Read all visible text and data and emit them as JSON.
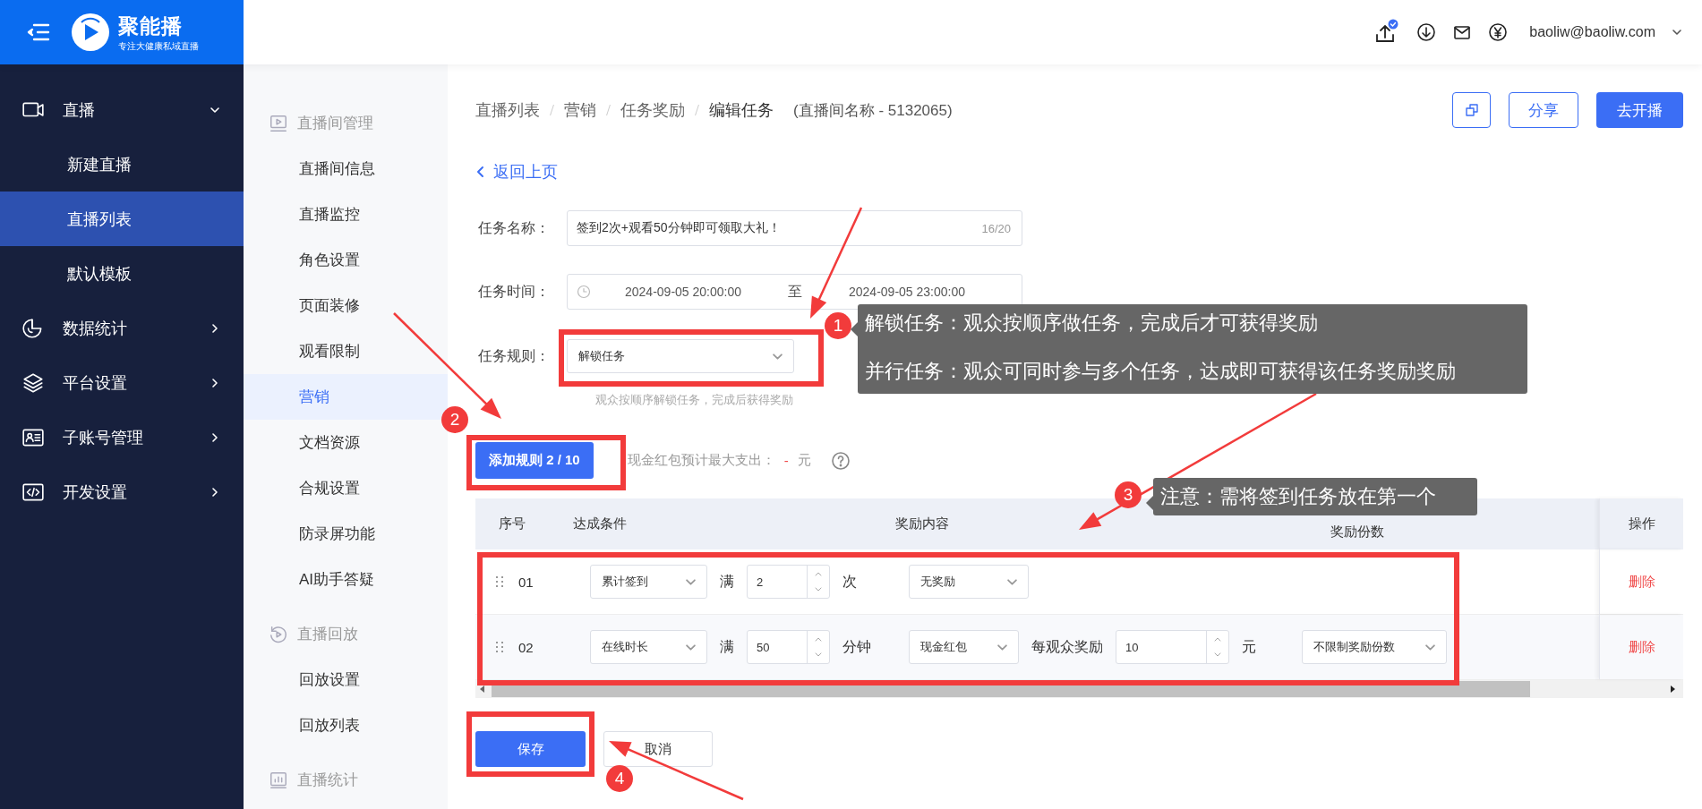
{
  "header": {
    "logo_text": "聚能播",
    "logo_tagline": "专注大健康私域直播",
    "user_email": "baoliw@baoliw.com"
  },
  "nav": [
    {
      "label": "直播",
      "expanded": true,
      "children": [
        {
          "label": "新建直播",
          "selected": false
        },
        {
          "label": "直播列表",
          "selected": true
        },
        {
          "label": "默认模板",
          "selected": false
        }
      ]
    },
    {
      "label": "数据统计",
      "expanded": false
    },
    {
      "label": "平台设置",
      "expanded": false
    },
    {
      "label": "子账号管理",
      "expanded": false
    },
    {
      "label": "开发设置",
      "expanded": false
    }
  ],
  "subnav": [
    {
      "heading": "直播间管理",
      "items": [
        {
          "label": "直播间信息",
          "selected": false
        },
        {
          "label": "直播监控",
          "selected": false
        },
        {
          "label": "角色设置",
          "selected": false
        },
        {
          "label": "页面装修",
          "selected": false
        },
        {
          "label": "观看限制",
          "selected": false
        },
        {
          "label": "营销",
          "selected": true
        },
        {
          "label": "文档资源",
          "selected": false
        },
        {
          "label": "合规设置",
          "selected": false
        },
        {
          "label": "防录屏功能",
          "selected": false
        },
        {
          "label": "AI助手答疑",
          "selected": false
        }
      ]
    },
    {
      "heading": "直播回放",
      "items": [
        {
          "label": "回放设置",
          "selected": false
        },
        {
          "label": "回放列表",
          "selected": false
        }
      ]
    },
    {
      "heading": "直播统计"
    }
  ],
  "breadcrumb": [
    "直播列表",
    "营销",
    "任务奖励",
    "编辑任务"
  ],
  "room_name": "(直播间名称 - 5132065)",
  "actions": [
    "分享",
    "去开播"
  ],
  "back_link": "返回上页",
  "form": {
    "name": {
      "label": "任务名称：",
      "value": "签到2次+观看50分钟即可领取大礼！",
      "counter": "16/20"
    },
    "time": {
      "label": "任务时间：",
      "start": "2024-09-05 20:00:00",
      "separator": "至",
      "end": "2024-09-05 23:00:00"
    },
    "rule": {
      "label": "任务规则：",
      "value": "解锁任务",
      "hint": "观众按顺序解锁任务，完成后获得奖励"
    }
  },
  "add_rule_button": "添加规则 2 / 10",
  "budget": {
    "label": "现金红包预计最大支出：",
    "value": "-",
    "unit": "元"
  },
  "table": {
    "columns": [
      "序号",
      "达成条件",
      "奖励内容",
      "奖励份数",
      "操作"
    ],
    "rows": [
      {
        "index": "01",
        "condition": "累计签到",
        "prefix": "满",
        "amount": "2",
        "unit": "次",
        "reward": "无奖励",
        "delete": "删除"
      },
      {
        "index": "02",
        "condition": "在线时长",
        "prefix": "满",
        "amount": "50",
        "unit": "分钟",
        "reward": "现金红包",
        "per_viewer_label": "每观众奖励",
        "per_viewer_amount": "10",
        "per_viewer_unit": "元",
        "quota": "不限制奖励份数",
        "delete": "删除"
      }
    ]
  },
  "footer_buttons": [
    "保存",
    "取消"
  ],
  "annotations": [
    {
      "number": "1",
      "text": [
        "解锁任务：观众按顺序做任务，完成后才可获得奖励",
        "并行任务：观众可同时参与多个任务，达成即可获得该任务奖励奖励"
      ]
    },
    {
      "number": "2"
    },
    {
      "number": "3",
      "text": [
        "注意：需将签到任务放在第一个"
      ]
    },
    {
      "number": "4"
    }
  ]
}
